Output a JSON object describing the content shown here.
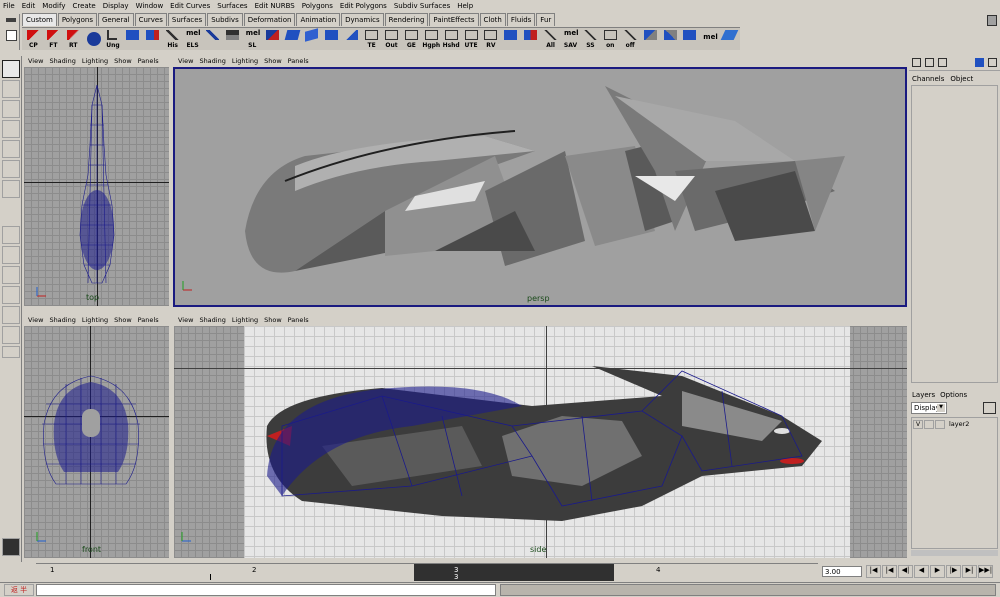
{
  "menubar": [
    "File",
    "Edit",
    "Modify",
    "Create",
    "Display",
    "Window",
    "Edit Curves",
    "Surfaces",
    "Edit NURBS",
    "Polygons",
    "Edit Polygons",
    "Subdiv Surfaces",
    "Help"
  ],
  "shelf_tabs": [
    "Custom",
    "Polygons",
    "General",
    "Curves",
    "Surfaces",
    "Subdivs",
    "Deformation",
    "Animation",
    "Dynamics",
    "Rendering",
    "PaintEffects",
    "Cloth",
    "Fluids",
    "Fur"
  ],
  "shelf_buttons": [
    "CP",
    "FT",
    "RT",
    "",
    "Ung",
    "",
    "",
    "His",
    "ELS",
    "",
    "SL",
    "",
    "",
    "",
    "",
    "",
    "TE",
    "Out",
    "GE",
    "Hgph",
    "Hshd",
    "UTE",
    "RV",
    "",
    "",
    "All",
    "SAV",
    "SS",
    "on",
    "off",
    "",
    "",
    "",
    "",
    ""
  ],
  "shelf_mel": {
    "mel1": "mel",
    "mel2": "mel",
    "mel3": "mel"
  },
  "panel_menu": [
    "View",
    "Shading",
    "Lighting",
    "Show",
    "Panels"
  ],
  "viewports": {
    "top": "top",
    "persp": "persp",
    "front": "front",
    "side": "side"
  },
  "channel_box": {
    "tabs": [
      "Channels",
      "Object"
    ]
  },
  "layer_box": {
    "menus": [
      "Layers",
      "Options"
    ],
    "display_select": "Display",
    "layer_visible": "V",
    "layer_name": "layer2"
  },
  "timeline": {
    "ticks": [
      "1",
      "2",
      "3",
      "4"
    ],
    "current_frame_marker": "3",
    "current_frame_marker_2": "3"
  },
  "time_controls": {
    "current_time": "3.00"
  },
  "status": {
    "icon_label": "返 半"
  },
  "colors": {
    "viewport_bg": "#a0a0a0",
    "persp_border": "#1a1a80",
    "wire": "#1a1a8a",
    "grid": "#7f7f7f"
  }
}
